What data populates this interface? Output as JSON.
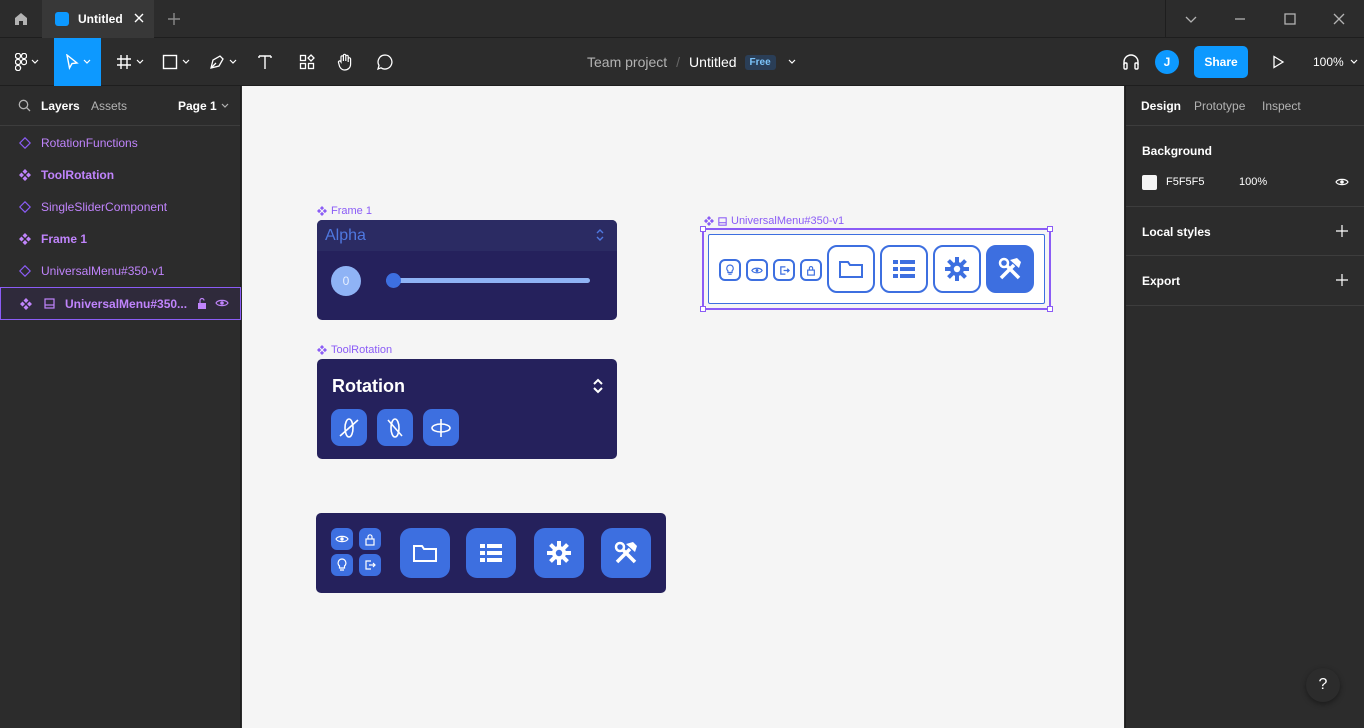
{
  "tabbar": {
    "tab_title": "Untitled"
  },
  "toolbar": {
    "project": "Team project",
    "separator": "/",
    "file_name": "Untitled",
    "plan_badge": "Free",
    "avatar_initial": "J",
    "share_label": "Share",
    "zoom": "100%"
  },
  "left_panel": {
    "tabs": {
      "layers": "Layers",
      "assets": "Assets"
    },
    "page": "Page 1",
    "layers": [
      {
        "label": "RotationFunctions"
      },
      {
        "label": "ToolRotation"
      },
      {
        "label": "SingleSliderComponent"
      },
      {
        "label": "Frame 1"
      },
      {
        "label": "UniversalMenu#350-v1"
      },
      {
        "label": "UniversalMenu#350..."
      }
    ]
  },
  "canvas": {
    "frame1_label": "Frame 1",
    "frame1_title": "Alpha",
    "slider_value": "0",
    "slider_level": 0,
    "toolrotation_label": "ToolRotation",
    "rotation_title": "Rotation",
    "universal_label": "UniversalMenu#350-v1"
  },
  "right_panel": {
    "tabs": {
      "design": "Design",
      "prototype": "Prototype",
      "inspect": "Inspect"
    },
    "background_title": "Background",
    "background_hex": "F5F5F5",
    "background_opacity": "100%",
    "local_styles": "Local styles",
    "export": "Export"
  },
  "help_label": "?",
  "colors": {
    "accent": "#0d99ff",
    "component": "#8b5cf6",
    "panel": "#25215c",
    "icon_blue": "#3d6fe0",
    "canvas": "#f5f5f5"
  }
}
